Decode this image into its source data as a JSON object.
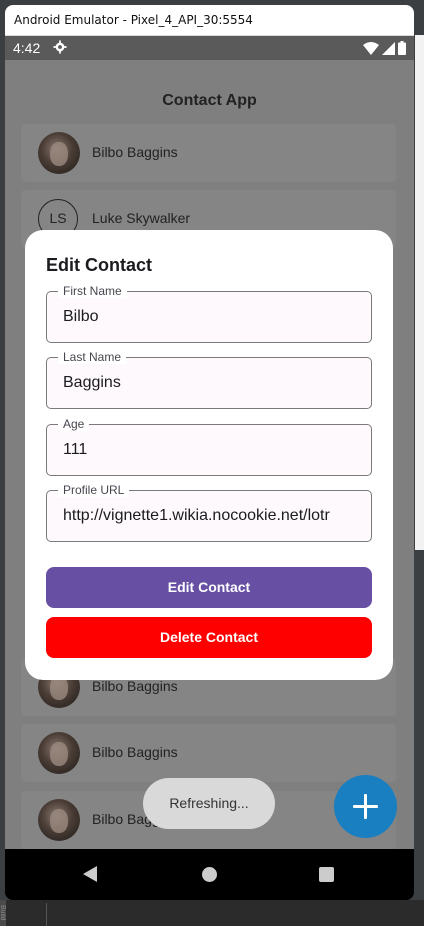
{
  "window": {
    "title": "Android Emulator - Pixel_4_API_30:5554"
  },
  "statusbar": {
    "time": "4:42"
  },
  "app": {
    "title": "Contact App"
  },
  "contacts": [
    {
      "name": "Bilbo Baggins",
      "avatar": "photo"
    },
    {
      "name": "Luke Skywalker",
      "avatar": "initials",
      "initials": "LS"
    },
    {
      "name": "Bilbo Baggins",
      "avatar": "photo"
    },
    {
      "name": "Bilbo Baggins",
      "avatar": "photo"
    },
    {
      "name": "Bilbo Baggins",
      "avatar": "photo"
    }
  ],
  "dialog": {
    "title": "Edit Contact",
    "fields": [
      {
        "label": "First Name",
        "value": "Bilbo"
      },
      {
        "label": "Last Name",
        "value": "Baggins"
      },
      {
        "label": "Age",
        "value": "111"
      },
      {
        "label": "Profile URL",
        "value": "http://vignette1.wikia.nocookie.net/lotr"
      }
    ],
    "edit_button": "Edit Contact",
    "delete_button": "Delete Contact"
  },
  "toast": {
    "text": "Refreshing..."
  },
  "ide": {
    "side_text": "Build V"
  },
  "icons": {
    "settings": "gear-icon",
    "wifi": "wifi-icon",
    "signal": "signal-icon",
    "battery": "battery-icon",
    "fab": "plus-icon",
    "nav_back": "back-icon",
    "nav_home": "home-icon",
    "nav_recent": "recents-icon"
  },
  "colors": {
    "primary": "#6750a4",
    "danger": "#ff0000",
    "fab": "#1a7fc0"
  }
}
